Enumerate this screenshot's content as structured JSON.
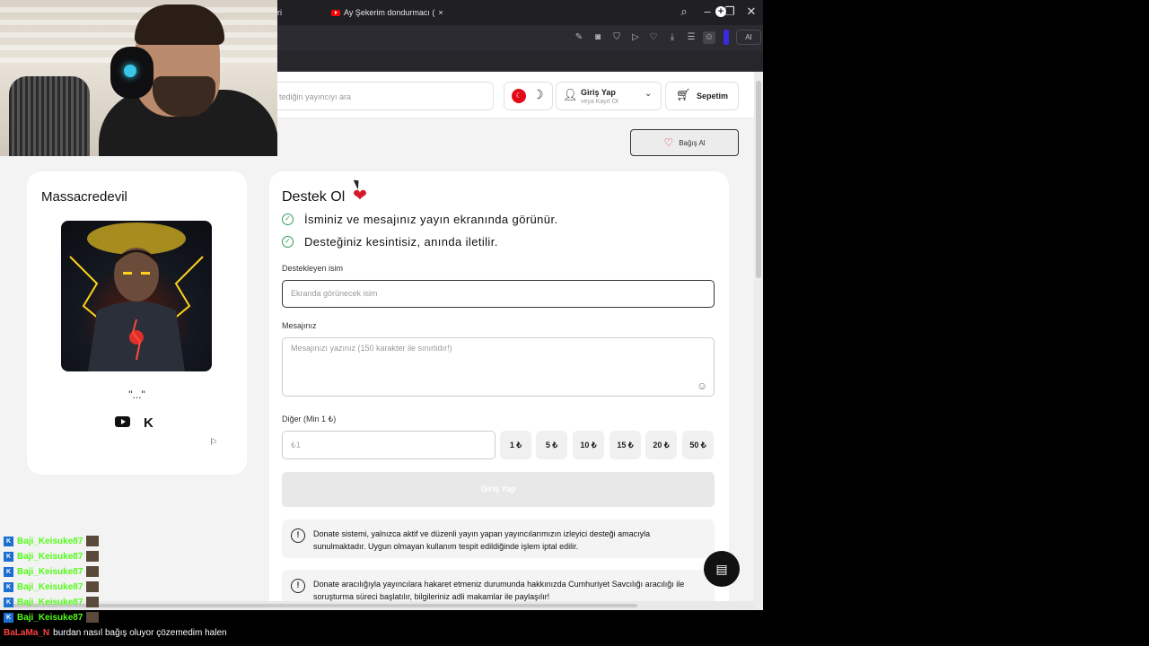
{
  "browser": {
    "tab_partial": "ri",
    "tab_active": "Ay Şekerim dondurmacı (",
    "ai_label": "AI"
  },
  "header": {
    "search_placeholder": "tediğin yayıncıyı ara",
    "login_title": "Giriş Yap",
    "login_sub": "veya Kayıt Ol",
    "cart_label": "Sepetim"
  },
  "bagis_button": "Bağış Al",
  "profile": {
    "name": "Massacredevil",
    "bio": "\"...\""
  },
  "donate": {
    "title": "Destek Ol",
    "benefits": [
      "İsminiz ve mesajınız yayın ekranında görünür.",
      "Desteğiniz kesintisiz, anında iletilir."
    ],
    "name_label": "Destekleyen isim",
    "name_placeholder": "Ekranda görünecek isim",
    "message_label": "Mesajınız",
    "message_placeholder": "Mesajınızı yazınız (150 karakter ile sınırlıdır!)",
    "amount_label": "Diğer (Min 1 ₺)",
    "amount_placeholder": "₺1",
    "chips": [
      "1 ₺",
      "5 ₺",
      "10 ₺",
      "15 ₺",
      "20 ₺",
      "50 ₺"
    ],
    "submit_label": "Giriş Yap",
    "notices": [
      "Donate sistemi, yalnızca aktif ve düzenli yayın yapan yayıncılarımızın izleyici desteği amacıyla sunulmaktadır. Uygun olmayan kullanım tespit edildiğinde işlem iptal edilir.",
      "Donate aracılığıyla yayıncılara hakaret etmeniz durumunda hakkınızda Cumhuriyet Savcılığı aracılığı ile soruşturma süreci başlatılır, bilgileriniz adli makamlar ile paylaşılır!"
    ]
  },
  "chat": {
    "lines": [
      "Baji_Keisuke87",
      "Baji_Keisuke87",
      "Baji_Keisuke87",
      "Baji_Keisuke87",
      "Baji_Keisuke87",
      "Baji_Keisuke87"
    ],
    "message_user": "BaLaMa_N",
    "message_text": "burdan nasıl bağış oluyor çözemedim halen"
  },
  "colors": {
    "accent_heart": "#d41a2a",
    "check_green": "#2e9c5a",
    "chat_user": "#53fc18"
  }
}
